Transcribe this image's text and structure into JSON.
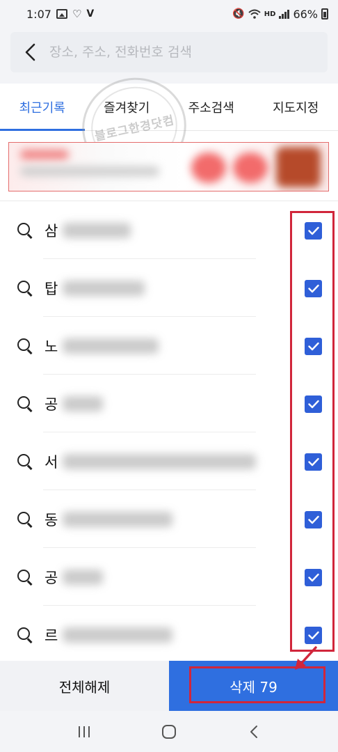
{
  "status_bar": {
    "time": "1:07",
    "network": "HD",
    "battery": "66%"
  },
  "search": {
    "placeholder": "장소, 주소, 전화번호 검색"
  },
  "tabs": [
    {
      "label": "최근기록",
      "active": true
    },
    {
      "label": "즐겨찾기",
      "active": false
    },
    {
      "label": "주소검색",
      "active": false
    },
    {
      "label": "지도지정",
      "active": false
    }
  ],
  "watermark": {
    "text": "블로그한경닷컴"
  },
  "recent_items": [
    {
      "label": "삼",
      "checked": true
    },
    {
      "label": "탑",
      "checked": true
    },
    {
      "label": "노",
      "checked": true
    },
    {
      "label": "공",
      "checked": true
    },
    {
      "label": "서",
      "checked": true
    },
    {
      "label": "동",
      "checked": true
    },
    {
      "label": "공",
      "checked": true
    },
    {
      "label": "르",
      "checked": true
    }
  ],
  "actions": {
    "deselect_all": "전체해제",
    "delete": "삭제 79"
  },
  "colors": {
    "accent": "#2f6fe0",
    "checkbox": "#2f5fd8",
    "annotation_red": "#d1263b"
  }
}
